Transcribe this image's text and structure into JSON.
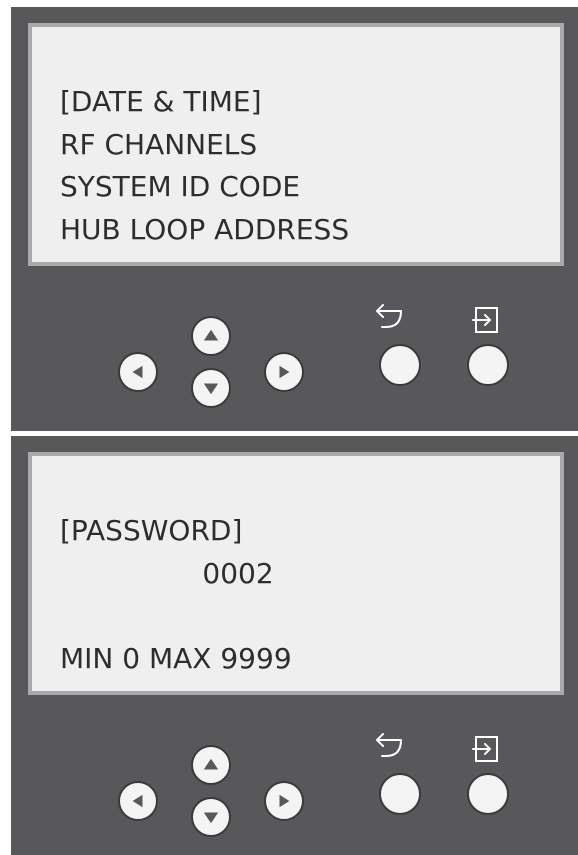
{
  "panels": [
    {
      "lines": [
        "[DATE & TIME]",
        "RF CHANNELS",
        "SYSTEM ID CODE",
        "HUB LOOP ADDRESS"
      ]
    },
    {
      "lines": [
        "[PASSWORD]",
        "                0002",
        "",
        "MIN 0 MAX 9999"
      ]
    }
  ],
  "buttons": {
    "left": {
      "icon": "triangle-left-icon"
    },
    "up": {
      "icon": "triangle-up-icon"
    },
    "down": {
      "icon": "triangle-down-icon"
    },
    "right": {
      "icon": "triangle-right-icon"
    },
    "back": {
      "icon": "back-arrow-icon"
    },
    "enter": {
      "icon": "enter-icon"
    }
  },
  "colors": {
    "panel": "#58585a",
    "screen_bg": "#efefef",
    "screen_border": "#a9a9ab",
    "text": "#2d2d2e",
    "button": "#f4f4f4",
    "glyph": "#58585a",
    "icon_stroke": "#ffffff"
  }
}
